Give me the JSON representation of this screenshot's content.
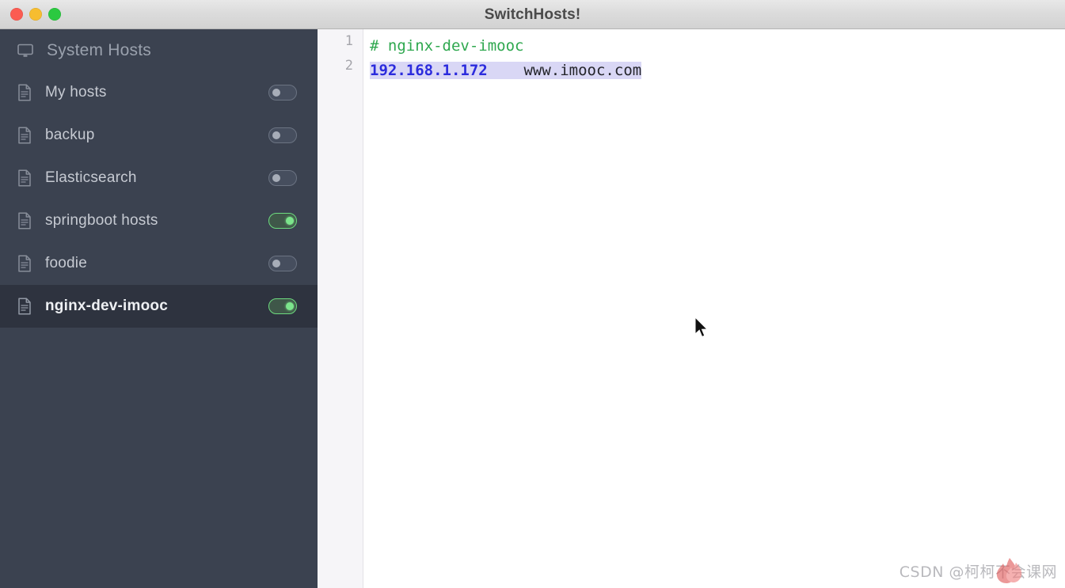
{
  "window": {
    "title": "SwitchHosts!",
    "controls": [
      {
        "name": "close",
        "color": "#fb5c52"
      },
      {
        "name": "minimize",
        "color": "#f6bd30"
      },
      {
        "name": "maximize",
        "color": "#2bc940"
      }
    ]
  },
  "sidebar": {
    "background": "#3b4250",
    "selected_background": "#2e333f",
    "system": {
      "label": "System Hosts",
      "icon": "monitor-icon"
    },
    "items": [
      {
        "label": "My hosts",
        "icon": "document-icon",
        "enabled": false,
        "selected": false
      },
      {
        "label": "backup",
        "icon": "document-icon",
        "enabled": false,
        "selected": false
      },
      {
        "label": "Elasticsearch",
        "icon": "document-icon",
        "enabled": false,
        "selected": false
      },
      {
        "label": "springboot hosts",
        "icon": "document-icon",
        "enabled": true,
        "selected": false
      },
      {
        "label": "foodie",
        "icon": "document-icon",
        "enabled": false,
        "selected": false
      },
      {
        "label": "nginx-dev-imooc",
        "icon": "document-icon",
        "enabled": true,
        "selected": true
      }
    ],
    "toggle_on_color": "#7ce58c",
    "toggle_off_color": "#a7adb8"
  },
  "editor": {
    "line_numbers": [
      "1",
      "2"
    ],
    "lines": [
      {
        "number": "1",
        "tokens": [
          {
            "text": "# nginx-dev-imooc",
            "type": "comment",
            "color": "#2fa84f"
          }
        ],
        "selected": false
      },
      {
        "number": "2",
        "tokens": [
          {
            "text": "192.168.1.172",
            "type": "ip",
            "color": "#2b2bdd"
          },
          {
            "text": "    ",
            "type": "space",
            "color": ""
          },
          {
            "text": "www.imooc.com",
            "type": "host",
            "color": "#23242a"
          }
        ],
        "selected": true,
        "selection_color": "#d9d7f5"
      }
    ],
    "full_text_line1": "# nginx-dev-imooc",
    "full_text_line2": "192.168.1.172    www.imooc.com"
  },
  "watermark": {
    "text": "CSDN @柯柯不会课网"
  }
}
